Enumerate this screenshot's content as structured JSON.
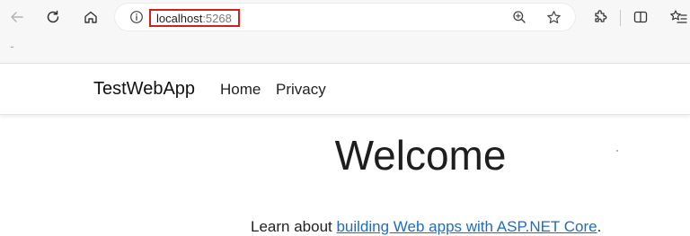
{
  "browser": {
    "url_host": "localhost",
    "url_port": ":5268"
  },
  "navbar": {
    "brand": "TestWebApp",
    "links": [
      "Home",
      "Privacy"
    ]
  },
  "main": {
    "heading": "Welcome",
    "learn_prefix": "Learn about ",
    "learn_link": "building Web apps with ASP.NET Core",
    "learn_suffix": "."
  },
  "colors": {
    "url_highlight": "#d0211e",
    "link": "#1b6ec2"
  },
  "icons": [
    "back-icon",
    "refresh-icon",
    "home-icon",
    "info-icon",
    "zoom-icon",
    "favorite-star-icon",
    "extensions-icon",
    "split-screen-icon",
    "favorites-list-icon"
  ]
}
